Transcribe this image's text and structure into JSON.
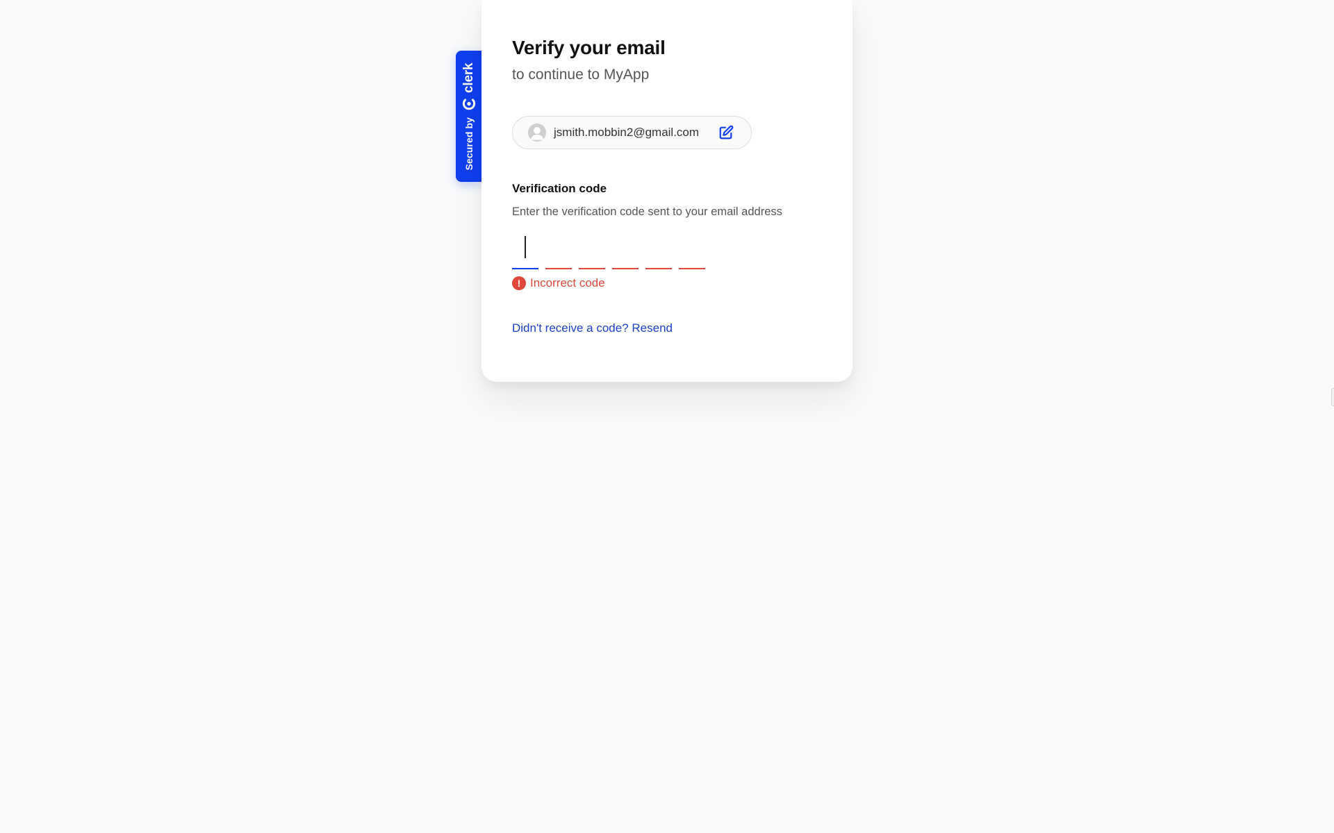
{
  "badge": {
    "secured_label": "Secured by",
    "brand_label": "clerk"
  },
  "card": {
    "title": "Verify your email",
    "subtitle": "to continue to MyApp"
  },
  "identity": {
    "email": "jsmith.mobbin2@gmail.com"
  },
  "verification": {
    "label": "Verification code",
    "hint": "Enter the verification code sent to your email address",
    "digits": [
      "",
      "",
      "",
      "",
      "",
      ""
    ],
    "error": "Incorrect code",
    "resend": "Didn't receive a code? Resend"
  },
  "colors": {
    "brand": "#103fef",
    "link": "#1a3fc7",
    "error": "#e0463a",
    "background": "#f9fafb"
  },
  "icons": {
    "badge_logo": "clerk-logo-icon",
    "avatar": "user-avatar-icon",
    "edit": "edit-pencil-icon",
    "error": "exclamation-circle-icon"
  }
}
